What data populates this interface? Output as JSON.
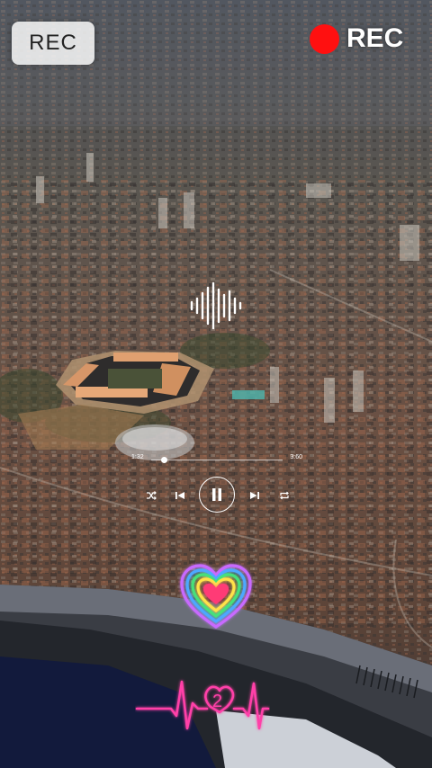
{
  "overlay": {
    "rec_badge_label": "REC",
    "rec_indicator_label": "REC",
    "rec_dot_color": "#ff1010"
  },
  "player": {
    "current_time": "1:32",
    "total_time": "3:60",
    "progress_fraction": 0.1,
    "icons": {
      "waveform": "sound-waveform-icon",
      "shuffle": "shuffle-icon",
      "previous": "previous-track-icon",
      "play_pause": "pause-icon",
      "next": "next-track-icon",
      "repeat": "repeat-icon"
    }
  },
  "stickers": {
    "heart": "rainbow-neon-heart",
    "ecg": "pink-neon-heartbeat-line",
    "neon_color": "#ff3fa8"
  }
}
